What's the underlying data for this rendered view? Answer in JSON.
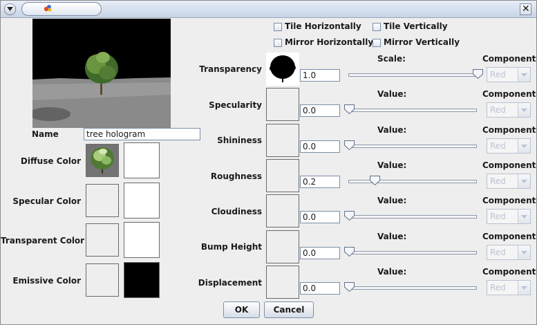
{
  "titlebar": {
    "menu_icon": "chevron-down-icon",
    "app_icon": "app-logo-icon",
    "close_glyph": "✕"
  },
  "name_label": "Name",
  "name_value": "tree hologram",
  "colors": {
    "diffuse_label": "Diffuse Color",
    "specular_label": "Specular Color",
    "transparent_label": "Transparent Color",
    "emissive_label": "Emissive Color"
  },
  "checkboxes": {
    "tile_h": "Tile Horizontally",
    "tile_v": "Tile Vertically",
    "mirror_h": "Mirror Horizontally",
    "mirror_v": "Mirror Vertically"
  },
  "properties": [
    {
      "label": "Transparency",
      "slider_caption": "Scale:",
      "value": "1.0",
      "slider_fraction": 1.0,
      "component_caption": "Component:",
      "component": "Red"
    },
    {
      "label": "Specularity",
      "slider_caption": "Value:",
      "value": "0.0",
      "slider_fraction": 0.0,
      "component_caption": "Component:",
      "component": "Red"
    },
    {
      "label": "Shininess",
      "slider_caption": "Value:",
      "value": "0.0",
      "slider_fraction": 0.0,
      "component_caption": "Component:",
      "component": "Red"
    },
    {
      "label": "Roughness",
      "slider_caption": "Value:",
      "value": "0.2",
      "slider_fraction": 0.2,
      "component_caption": "Component:",
      "component": "Red"
    },
    {
      "label": "Cloudiness",
      "slider_caption": "Value:",
      "value": "0.0",
      "slider_fraction": 0.0,
      "component_caption": "Component:",
      "component": "Red"
    },
    {
      "label": "Bump Height",
      "slider_caption": "Value:",
      "value": "0.0",
      "slider_fraction": 0.0,
      "component_caption": "Component:",
      "component": "Red"
    },
    {
      "label": "Displacement",
      "slider_caption": "Value:",
      "value": "0.0",
      "slider_fraction": 0.0,
      "component_caption": "Component:",
      "component": "Red"
    }
  ],
  "buttons": {
    "ok": "OK",
    "cancel": "Cancel"
  }
}
